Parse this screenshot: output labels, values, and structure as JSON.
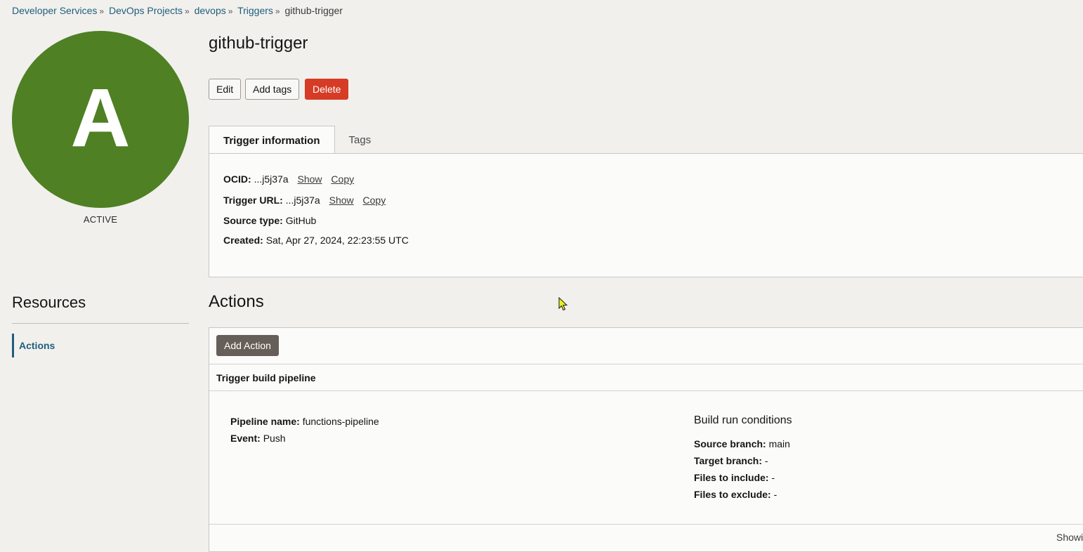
{
  "breadcrumb": [
    {
      "label": "Developer Services"
    },
    {
      "label": "DevOps Projects"
    },
    {
      "label": "devops"
    },
    {
      "label": "Triggers"
    }
  ],
  "breadcrumb_current": "github-trigger",
  "avatar": {
    "letter": "A",
    "color": "#4f8024"
  },
  "status": "ACTIVE",
  "title": "github-trigger",
  "buttons": {
    "edit": "Edit",
    "add_tags": "Add tags",
    "delete": "Delete"
  },
  "tabs": [
    {
      "label": "Trigger information"
    },
    {
      "label": "Tags"
    }
  ],
  "info": {
    "ocid_label": "OCID:",
    "ocid_value": "...j5j37a",
    "url_label": "Trigger URL:",
    "url_value": "...j5j37a",
    "show": "Show",
    "copy": "Copy",
    "source_label": "Source type:",
    "source_value": "GitHub",
    "created_label": "Created:",
    "created_value": "Sat, Apr 27, 2024, 22:23:55 UTC"
  },
  "resources": {
    "title": "Resources",
    "items": [
      {
        "label": "Actions"
      }
    ]
  },
  "actions": {
    "title": "Actions",
    "add_button": "Add Action",
    "item_title": "Trigger build pipeline",
    "pipeline_label": "Pipeline name:",
    "pipeline_value": "functions-pipeline",
    "event_label": "Event:",
    "event_value": "Push",
    "conditions_title": "Build run conditions",
    "source_branch_label": "Source branch:",
    "source_branch_value": "main",
    "target_branch_label": "Target branch:",
    "target_branch_value": "-",
    "include_label": "Files to include:",
    "include_value": "-",
    "exclude_label": "Files to exclude:",
    "exclude_value": "-",
    "showing": "Showi"
  },
  "colors": {
    "link": "#1f5e7d",
    "delete": "#d63b25",
    "add_action": "#665e59"
  }
}
